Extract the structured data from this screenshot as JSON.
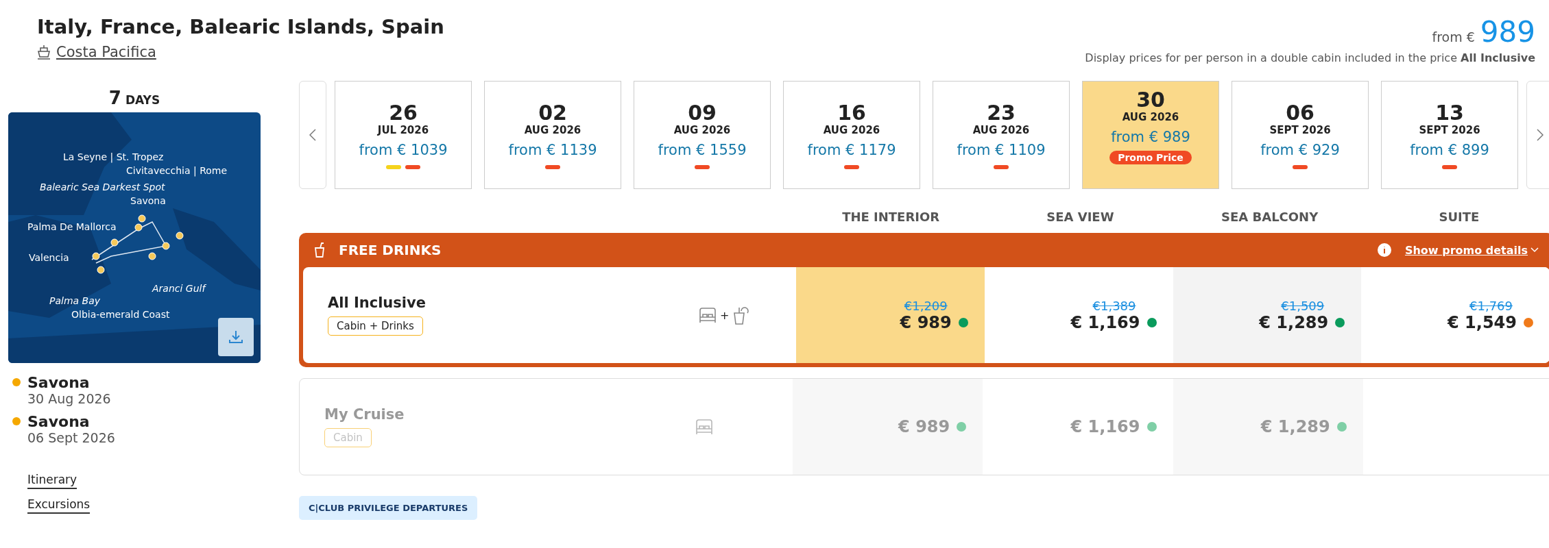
{
  "title": "Italy, France, Balearic Islands, Spain",
  "ship": "Costa Pacifica",
  "price_summary": {
    "prefix": "from €",
    "amount": "989",
    "note": "Display prices for per person in a double cabin included in the price **All Inclusive**"
  },
  "duration": {
    "number": "7",
    "unit": "DAYS"
  },
  "map_labels": [
    {
      "text": "La Seyne | St. Tropez",
      "italic": false
    },
    {
      "text": "Civitavecchia | Rome",
      "italic": false
    },
    {
      "text": "Balearic Sea Darkest Spot",
      "italic": true
    },
    {
      "text": "Savona",
      "italic": false
    },
    {
      "text": "Palma De Mallorca",
      "italic": false
    },
    {
      "text": "Valencia",
      "italic": false
    },
    {
      "text": "Aranci Gulf",
      "italic": true
    },
    {
      "text": "Palma Bay",
      "italic": true
    },
    {
      "text": "Olbia-emerald Coast",
      "italic": false
    }
  ],
  "route": [
    {
      "port": "Savona",
      "date": "30 Aug 2026"
    },
    {
      "port": "Savona",
      "date": "06 Sept 2026"
    }
  ],
  "links": [
    "Itinerary",
    "Excursions"
  ],
  "departures": [
    {
      "day": "26",
      "month": "JUL 2026",
      "price": "from € 1039",
      "selected": false,
      "markers": [
        {
          "color": "#f5d31c"
        },
        {
          "color": "#f04a24"
        }
      ]
    },
    {
      "day": "02",
      "month": "AUG 2026",
      "price": "from € 1139",
      "selected": false,
      "markers": [
        {
          "color": "#f04a24"
        }
      ]
    },
    {
      "day": "09",
      "month": "AUG 2026",
      "price": "from € 1559",
      "selected": false,
      "markers": [
        {
          "color": "#f04a24"
        }
      ]
    },
    {
      "day": "16",
      "month": "AUG 2026",
      "price": "from € 1179",
      "selected": false,
      "markers": [
        {
          "color": "#f04a24"
        }
      ]
    },
    {
      "day": "23",
      "month": "AUG 2026",
      "price": "from € 1109",
      "selected": false,
      "markers": [
        {
          "color": "#f04a24"
        }
      ]
    },
    {
      "day": "30",
      "month": "AUG 2026",
      "price": "from € 989",
      "selected": true,
      "badge": "Promo Price"
    },
    {
      "day": "06",
      "month": "SEPT 2026",
      "price": "from € 929",
      "selected": false,
      "markers": [
        {
          "color": "#f04a24"
        }
      ]
    },
    {
      "day": "13",
      "month": "SEPT 2026",
      "price": "from € 899",
      "selected": false,
      "markers": [
        {
          "color": "#f04a24"
        }
      ]
    }
  ],
  "cabin_columns": [
    "THE INTERIOR",
    "SEA VIEW",
    "SEA BALCONY",
    "SUITE"
  ],
  "promo": {
    "title": "FREE DRINKS",
    "details_link": "Show promo details"
  },
  "fares": [
    {
      "name": "All Inclusive",
      "tag": "Cabin + Drinks",
      "kind": "drinks",
      "joiner": "+",
      "disabled": false,
      "prices": [
        {
          "old": "€1,209",
          "price": "€ 989",
          "color": "#0a9b5c",
          "selected": true
        },
        {
          "old": "€1,389",
          "price": "€ 1,169",
          "color": "#0a9b5c",
          "selected": false
        },
        {
          "old": "€1,509",
          "price": "€ 1,289",
          "color": "#0a9b5c",
          "selected": false
        },
        {
          "old": "€1,769",
          "price": "€ 1,549",
          "color": "#f07a1a",
          "selected": false
        }
      ]
    },
    {
      "name": "My Cruise",
      "tag": "Cabin",
      "kind": "cabin",
      "disabled": true,
      "prices": [
        {
          "price": "€ 989",
          "color": "#7fcfa6",
          "selected": false
        },
        {
          "price": "€ 1,169",
          "color": "#7fcfa6",
          "selected": false
        },
        {
          "price": "€ 1,289",
          "color": "#7fcfa6",
          "selected": false
        }
      ]
    }
  ],
  "club_badge": "C|CLUB PRIVILEGE DEPARTURES"
}
